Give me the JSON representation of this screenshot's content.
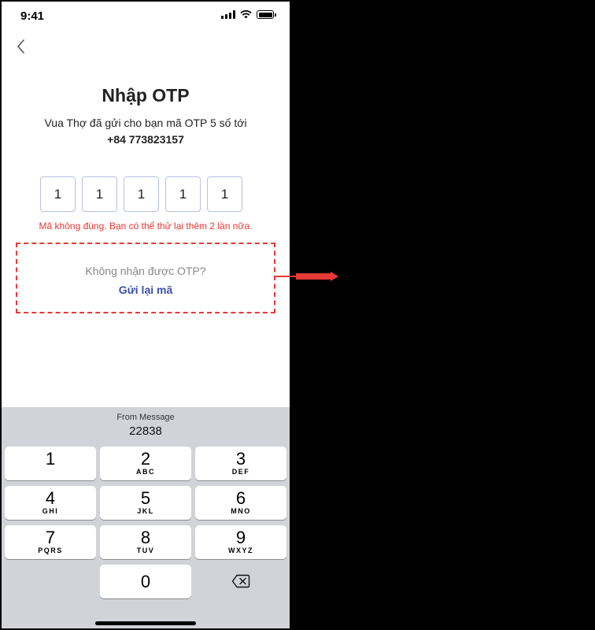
{
  "status_bar": {
    "time": "9:41"
  },
  "header": {
    "title": "Nhập OTP"
  },
  "message": {
    "text": "Vua Thợ đã gửi cho bạn mã OTP 5 số tới",
    "phone": "+84 773823157"
  },
  "otp": {
    "digits": [
      "1",
      "1",
      "1",
      "1",
      "1"
    ]
  },
  "error": "Mã không đúng. Bạn có thể thử lại thêm 2 lần nữa.",
  "resend": {
    "question": "Không nhận được OTP?",
    "link": "Gửi lại mã"
  },
  "keyboard": {
    "suggestion_label": "From Message",
    "suggestion_code": "22838",
    "keys": [
      {
        "num": "1",
        "letters": ""
      },
      {
        "num": "2",
        "letters": "ABC"
      },
      {
        "num": "3",
        "letters": "DEF"
      },
      {
        "num": "4",
        "letters": "GHI"
      },
      {
        "num": "5",
        "letters": "JKL"
      },
      {
        "num": "6",
        "letters": "MNO"
      },
      {
        "num": "7",
        "letters": "PQRS"
      },
      {
        "num": "8",
        "letters": "TUV"
      },
      {
        "num": "9",
        "letters": "WXYZ"
      },
      {
        "num": "0",
        "letters": ""
      }
    ],
    "delete_icon": "backspace-icon"
  },
  "colors": {
    "error": "#e53935",
    "link": "#3b4fa8",
    "otp_border": "#b9bfe6",
    "keyboard_bg": "#d1d3d9"
  }
}
